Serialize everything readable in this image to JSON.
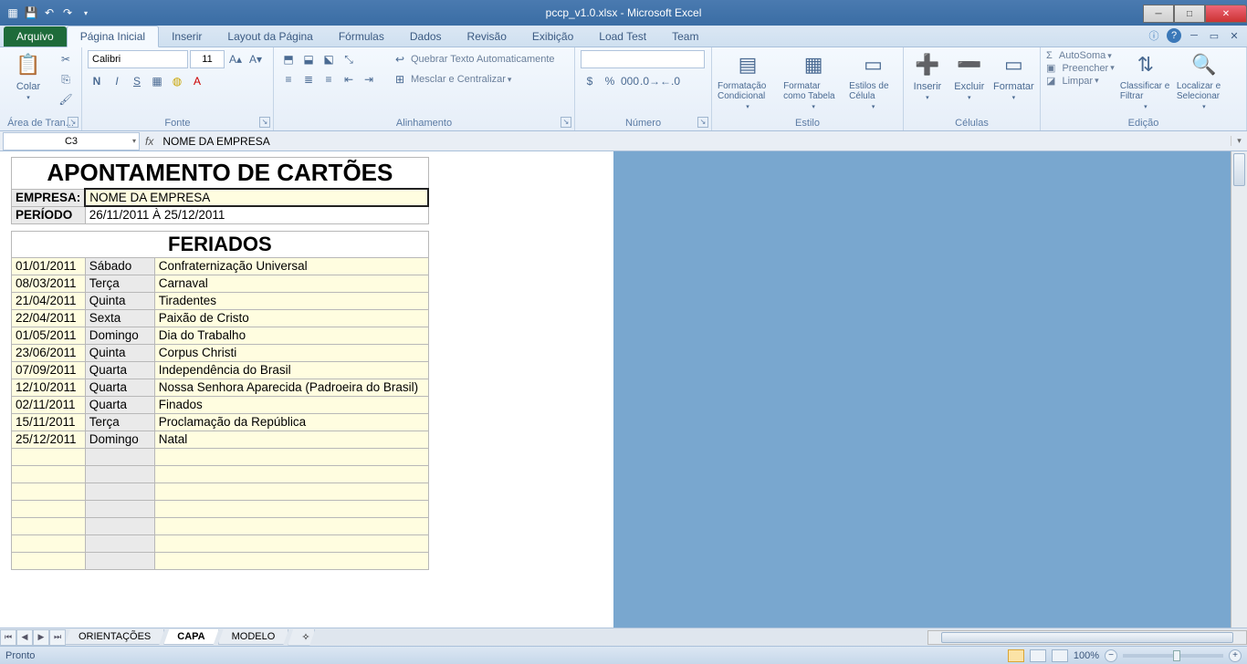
{
  "titlebar": {
    "title": "pccp_v1.0.xlsx - Microsoft Excel"
  },
  "tabs": {
    "file": "Arquivo",
    "items": [
      "Página Inicial",
      "Inserir",
      "Layout da Página",
      "Fórmulas",
      "Dados",
      "Revisão",
      "Exibição",
      "Load Test",
      "Team"
    ],
    "active": 0
  },
  "ribbon": {
    "clipboard": {
      "paste": "Colar",
      "group": "Área de Tran..."
    },
    "font": {
      "name": "Calibri",
      "size": "11",
      "group": "Fonte",
      "bold": "N",
      "italic": "I",
      "underline": "S"
    },
    "align": {
      "wrap": "Quebrar Texto Automaticamente",
      "merge": "Mesclar e Centralizar",
      "group": "Alinhamento"
    },
    "number": {
      "group": "Número"
    },
    "styles": {
      "cond": "Formatação Condicional",
      "table": "Formatar como Tabela",
      "cell": "Estilos de Célula",
      "group": "Estilo"
    },
    "cells": {
      "insert": "Inserir",
      "delete": "Excluir",
      "format": "Formatar",
      "group": "Células"
    },
    "editing": {
      "autosum": "AutoSoma",
      "fill": "Preencher",
      "clear": "Limpar",
      "sort": "Classificar e Filtrar",
      "find": "Localizar e Selecionar",
      "group": "Edição"
    }
  },
  "formulaBar": {
    "cell": "C3",
    "value": "NOME DA EMPRESA"
  },
  "worksheet": {
    "title": "APONTAMENTO DE CARTÕES",
    "empresaLabel": "EMPRESA:",
    "empresaValue": "NOME DA EMPRESA",
    "periodoLabel": "PERÍODO",
    "periodoValue": "26/11/2011    À    25/12/2011",
    "feriadosHeader": "FERIADOS",
    "feriados": [
      {
        "date": "01/01/2011",
        "day": "Sábado",
        "desc": "Confraternização Universal"
      },
      {
        "date": "08/03/2011",
        "day": "Terça",
        "desc": "Carnaval"
      },
      {
        "date": "21/04/2011",
        "day": "Quinta",
        "desc": "Tiradentes"
      },
      {
        "date": "22/04/2011",
        "day": "Sexta",
        "desc": "Paixão de Cristo"
      },
      {
        "date": "01/05/2011",
        "day": "Domingo",
        "desc": "Dia do Trabalho"
      },
      {
        "date": "23/06/2011",
        "day": "Quinta",
        "desc": "Corpus Christi"
      },
      {
        "date": "07/09/2011",
        "day": "Quarta",
        "desc": "Independência do Brasil"
      },
      {
        "date": "12/10/2011",
        "day": "Quarta",
        "desc": "Nossa Senhora Aparecida (Padroeira do Brasil)"
      },
      {
        "date": "02/11/2011",
        "day": "Quarta",
        "desc": "Finados"
      },
      {
        "date": "15/11/2011",
        "day": "Terça",
        "desc": "Proclamação da República"
      },
      {
        "date": "25/12/2011",
        "day": "Domingo",
        "desc": "Natal"
      }
    ],
    "blankRows": 7
  },
  "sheetTabs": {
    "items": [
      "ORIENTAÇÕES",
      "CAPA",
      "MODELO"
    ],
    "active": 1
  },
  "status": {
    "ready": "Pronto",
    "zoom": "100%"
  }
}
